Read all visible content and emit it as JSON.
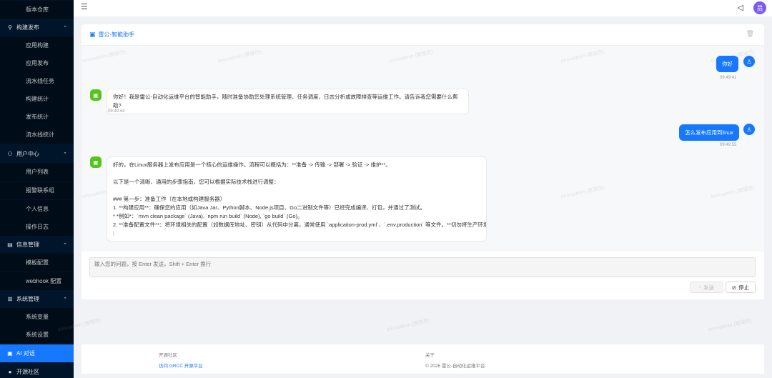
{
  "sidebar": {
    "items": [
      {
        "label": "版本仓库",
        "type": "sub"
      },
      {
        "label": "构建发布",
        "type": "group",
        "icon": "rocket-icon"
      },
      {
        "label": "应用构建",
        "type": "sub"
      },
      {
        "label": "应用发布",
        "type": "sub"
      },
      {
        "label": "流水线任务",
        "type": "sub"
      },
      {
        "label": "构建统计",
        "type": "sub"
      },
      {
        "label": "发布统计",
        "type": "sub"
      },
      {
        "label": "流水线统计",
        "type": "sub"
      },
      {
        "label": "用户中心",
        "type": "group",
        "icon": "user-icon"
      },
      {
        "label": "用户列表",
        "type": "sub"
      },
      {
        "label": "报警联系组",
        "type": "sub"
      },
      {
        "label": "个人信息",
        "type": "sub"
      },
      {
        "label": "操作日志",
        "type": "sub"
      },
      {
        "label": "信息管理",
        "type": "group",
        "icon": "doc-icon"
      },
      {
        "label": "模板配置",
        "type": "sub"
      },
      {
        "label": "webhook 配置",
        "type": "sub"
      },
      {
        "label": "系统管理",
        "type": "group",
        "icon": "settings-icon"
      },
      {
        "label": "系统变量",
        "type": "sub"
      },
      {
        "label": "系统设置",
        "type": "sub"
      },
      {
        "label": "AI 对话",
        "type": "active",
        "icon": "chat-icon"
      },
      {
        "label": "开源社区",
        "type": "top",
        "icon": "github-icon"
      }
    ]
  },
  "header": {
    "avatar_text": "员"
  },
  "card": {
    "title": "雷公-智能助手"
  },
  "messages": [
    {
      "role": "user",
      "text": "你好",
      "time": "09:49:41"
    },
    {
      "role": "bot",
      "lines": [
        "你好！我是雷公-自动化运维平台的智能助手，随时准备协助您处理系统管理、任务调度、日志分析或故障排查等运维工作。请告诉我您需要什么帮助?"
      ],
      "time": "09:49:44"
    },
    {
      "role": "user",
      "text": "怎么发布应用到linux",
      "time": "09:49:55"
    },
    {
      "role": "bot",
      "lines": [
        "好的，在Linux服务器上发布应用是一个核心的运维操作。流程可以概括为：**准备 -> 传输 -> 部署 -> 验证 -> 维护**。",
        "",
        "以下是一个清晰、通用的步骤指南，您可以根据实际技术栈进行调整：",
        "",
        "### 第一步：准备工作（在本地或构建服务器）",
        "1. **构建应用**：确保您的应用（如Java Jar、Python脚本、Node.js项目、Go二进制文件等）已经完成编译、打包，并通过了测试。",
        "* *例如*：`mvn clean package` (Java), `npm run build` (Node), `go build` (Go)。",
        "2. **准备配置文件**：将环境相关的配置（如数据库地址、密钥）从代码中分离，通常使用 `application-prod.yml`、`.env.production` 等文件。**切勿将生产环境",
        "|"
      ],
      "time": ""
    }
  ],
  "input": {
    "placeholder": "输入您的问题，按 Enter 发送，Shift + Enter 换行"
  },
  "buttons": {
    "send": "发送",
    "stop": "停止"
  },
  "footer": {
    "left_heading": "开源社区",
    "left_link": "访问 GRCC 开源平台",
    "right_heading": "关于",
    "right_text": "© 2026 雷公-自动化运维平台"
  },
  "watermark": "orionadmin (管理员)",
  "colors": {
    "sidebar_bg": "#001529",
    "primary": "#1677ff",
    "bot_avatar": "#52c41a",
    "avatar": "#7a5cf5"
  }
}
